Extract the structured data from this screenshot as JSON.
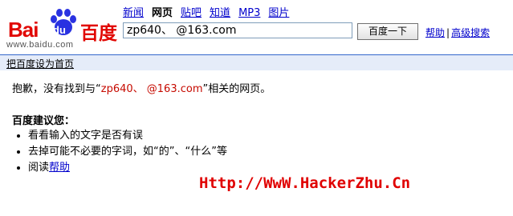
{
  "logo": {
    "bai": "Bai",
    "du": "du",
    "cn": "百度",
    "url": "www.baidu.com"
  },
  "nav": {
    "items": [
      "新闻",
      "网页",
      "贴吧",
      "知道",
      "MP3",
      "图片"
    ],
    "active": "网页"
  },
  "search": {
    "value": "zp640、   @163.com",
    "button_label": "百度一下"
  },
  "links": {
    "help": "帮助",
    "sep": "|",
    "advanced": "高级搜索"
  },
  "bar": {
    "set_home": "把百度设为首页"
  },
  "result": {
    "prefix": "抱歉，没有找到与“",
    "query": "zp640、   @163.com",
    "suffix": "”相关的网页。"
  },
  "suggestions": {
    "title": "百度建议您：",
    "items": [
      "看看输入的文字是否有误",
      "去掉可能不必要的字词，如“的”、“什么”等"
    ],
    "read_prefix": "阅读",
    "read_link": "帮助"
  },
  "watermark": "Http://WwW.HackerZhu.Cn"
}
